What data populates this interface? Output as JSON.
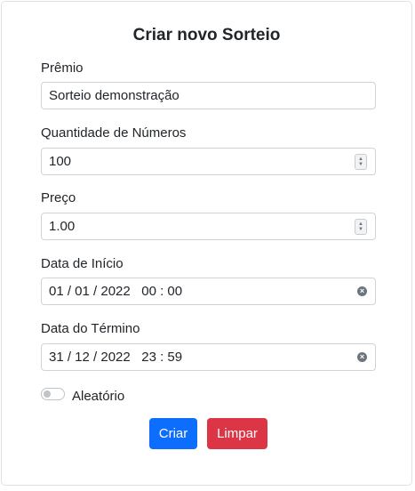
{
  "form": {
    "title": "Criar novo Sorteio",
    "premio": {
      "label": "Prêmio",
      "value": "Sorteio demonstração"
    },
    "quantidade": {
      "label": "Quantidade de Números",
      "value": "100"
    },
    "preco": {
      "label": "Preço",
      "value": "1.00"
    },
    "data_inicio": {
      "label": "Data de Início",
      "value": "01 / 01 / 2022   00 : 00"
    },
    "data_termino": {
      "label": "Data do Término",
      "value": "31 / 12 / 2022   23 : 59"
    },
    "aleatorio": {
      "label": "Aleatório",
      "checked": false
    },
    "buttons": {
      "criar": "Criar",
      "limpar": "Limpar"
    }
  },
  "icons": {
    "spinner": "spinner-arrows-icon",
    "clear": "clear-x-icon"
  },
  "colors": {
    "primary": "#0d6efd",
    "danger": "#dc3545",
    "border": "#ced4da"
  }
}
